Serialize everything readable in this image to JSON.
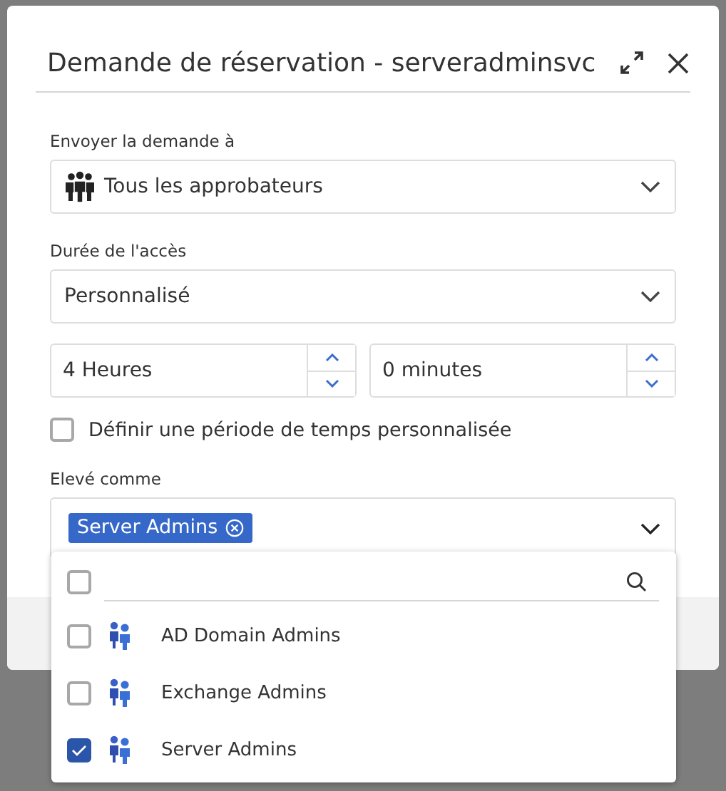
{
  "dialog": {
    "title": "Demande de réservation - serveradminsvc",
    "send_to": {
      "label": "Envoyer la demande à",
      "value": "Tous les approbateurs"
    },
    "duration": {
      "label": "Durée de l'accès",
      "value": "Personnalisé"
    },
    "hours": {
      "value": "4 Heures"
    },
    "minutes": {
      "value": "0 minutes"
    },
    "custom_period": {
      "label": "Définir une période de temps personnalisée",
      "checked": false
    },
    "elevated_as": {
      "label": "Elevé comme",
      "tags": [
        {
          "label": "Server Admins"
        }
      ]
    }
  },
  "dropdown": {
    "select_all": {
      "checked": false
    },
    "options": [
      {
        "label": "AD Domain Admins",
        "checked": false
      },
      {
        "label": "Exchange Admins",
        "checked": false
      },
      {
        "label": "Server Admins",
        "checked": true
      }
    ]
  }
}
